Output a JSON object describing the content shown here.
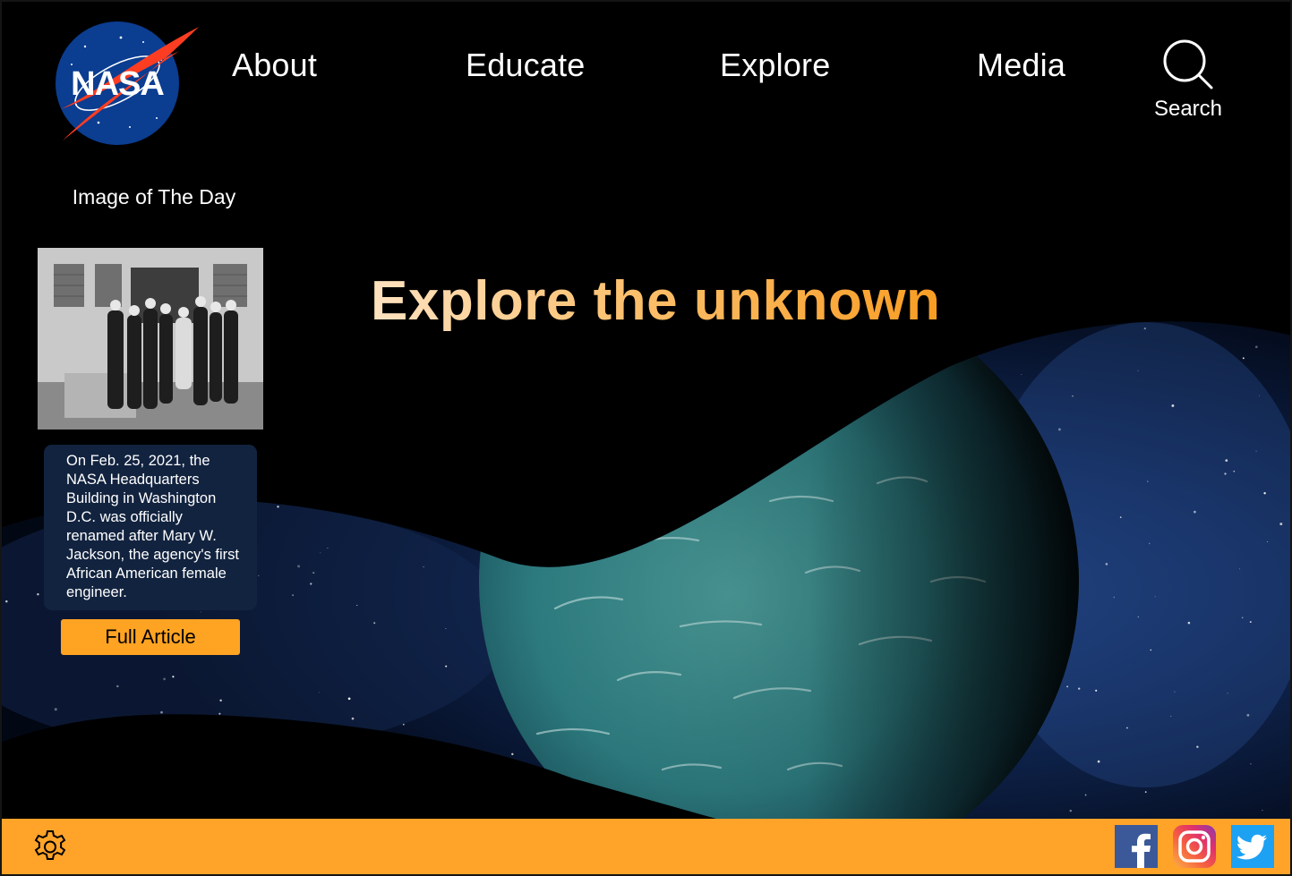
{
  "header": {
    "logo_text": "NASA",
    "nav": [
      {
        "label": "About"
      },
      {
        "label": "Educate"
      },
      {
        "label": "Explore"
      },
      {
        "label": "Media"
      }
    ],
    "search_label": "Search"
  },
  "sidebar": {
    "title": "Image of The Day",
    "caption": "On Feb. 25, 2021, the NASA Headquarters Building in Washington D.C. was officially renamed after Mary W. Jackson, the agency's first African American female engineer.",
    "button_label": "Full Article"
  },
  "hero": {
    "title": "Explore the unknown"
  },
  "footer": {
    "icons": [
      "gear-icon",
      "facebook-icon",
      "instagram-icon",
      "twitter-icon"
    ]
  },
  "colors": {
    "accent": "#ffa429",
    "card_bg": "#12233f",
    "logo_blue": "#0b3d91",
    "logo_red": "#fc3d21"
  }
}
